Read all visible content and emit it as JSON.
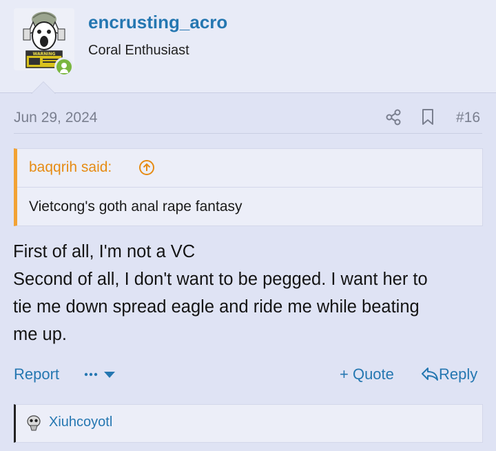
{
  "user": {
    "username": "encrusting_acro",
    "title": "Coral Enthusiast",
    "avatar_warning_text": "WARNING",
    "online": true
  },
  "post": {
    "date": "Jun 29, 2024",
    "number": "#16",
    "quote": {
      "author_label": "baqqrih said:",
      "text": "Vietcong's goth anal rape fantasy"
    },
    "body_lines": [
      "First of all, I'm not a VC",
      "Second of all, I don't want to be pegged. I want her to",
      "tie me down spread eagle and ride me while beating",
      "me up."
    ]
  },
  "actions": {
    "report_label": "Report",
    "quote_label": "+ Quote",
    "reply_label": "Reply"
  },
  "reactions": {
    "users": "Xiuhcoyotl"
  },
  "colors": {
    "link": "#2577b1",
    "quote_accent": "#f2a234",
    "background": "#dfe3f4",
    "online": "#7ab640"
  },
  "icons": [
    "share-icon",
    "bookmark-icon",
    "arrow-up-circle-icon",
    "ellipsis-icon",
    "caret-down-icon",
    "reply-icon",
    "online-user-icon"
  ]
}
